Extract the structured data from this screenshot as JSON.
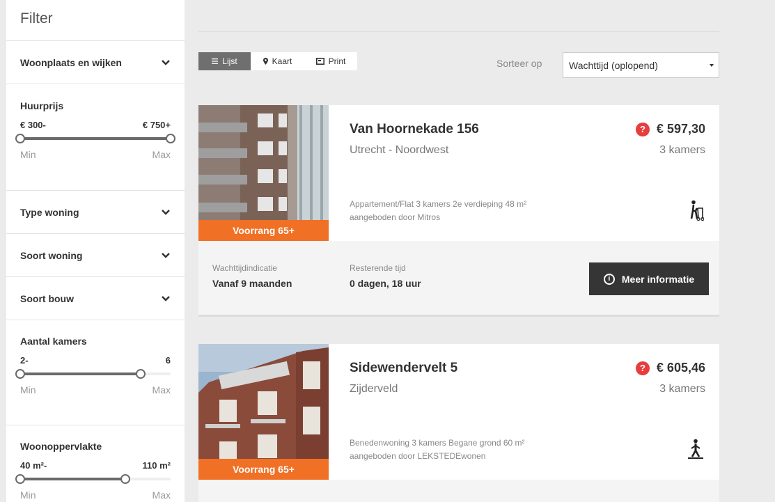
{
  "sidebar": {
    "title": "Filter",
    "woonplaats": "Woonplaats en wijken",
    "huurprijs": {
      "label": "Huurprijs",
      "min_value": "€ 300-",
      "max_value": "€ 750+",
      "min_label": "Min",
      "max_label": "Max",
      "range": [
        0.0,
        1.0
      ]
    },
    "type_woning": "Type woning",
    "soort_woning": "Soort woning",
    "soort_bouw": "Soort bouw",
    "aantal_kamers": {
      "label": "Aantal kamers",
      "min_value": "2-",
      "max_value": "6",
      "min_label": "Min",
      "max_label": "Max",
      "range": [
        0.0,
        0.8
      ]
    },
    "woonoppervlakte": {
      "label": "Woonoppervlakte",
      "min_value": "40 m²-",
      "max_value": "110 m²",
      "min_label": "Min",
      "max_label": "Max",
      "range": [
        0.0,
        0.7
      ]
    }
  },
  "toolbar": {
    "lijst": "Lijst",
    "kaart": "Kaart",
    "print": "Print",
    "sort_label": "Sorteer op",
    "sort_value": "Wachttijd (oplopend)"
  },
  "listings": [
    {
      "badge": "Voorrang 65+",
      "address": "Van Hoornekade 156",
      "city": "Utrecht - Noordwest",
      "price": "€ 597,30",
      "rooms": "3 kamers",
      "desc1": "Appartement/Flat 3 kamers 2e verdieping 48 m²",
      "desc2": "aangeboden door Mitros",
      "wacht_label": "Wachttijdindicatie",
      "wacht_value": "Vanaf 9 maanden",
      "rest_label": "Resterende tijd",
      "rest_value": "0 dagen, 18 uur",
      "button": "Meer informatie"
    },
    {
      "badge": "Voorrang 65+",
      "address": "Sidewendervelt 5",
      "city": "Zijderveld",
      "price": "€ 605,46",
      "rooms": "3 kamers",
      "desc1": "Benedenwoning 3 kamers Begane grond 60 m²",
      "desc2": "aangeboden door LEKSTEDEwonen"
    }
  ]
}
